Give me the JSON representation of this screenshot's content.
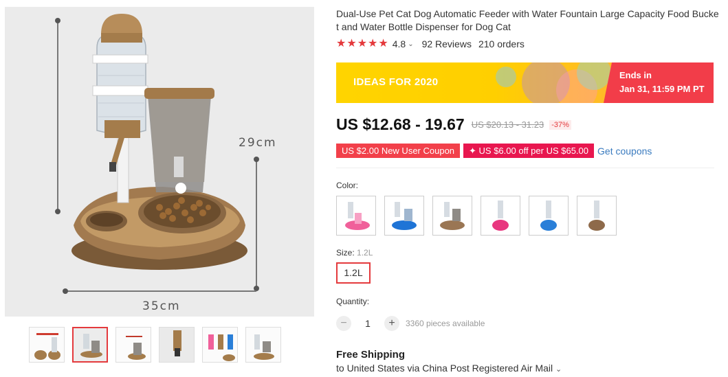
{
  "main_image": {
    "width_label": "35cm",
    "height_label": "29cm"
  },
  "thumbnails": [
    {
      "name": "thumbnail-1"
    },
    {
      "name": "thumbnail-2",
      "active": true
    },
    {
      "name": "thumbnail-3"
    },
    {
      "name": "thumbnail-4"
    },
    {
      "name": "thumbnail-5"
    },
    {
      "name": "thumbnail-6"
    }
  ],
  "product": {
    "title": "Dual-Use Pet Cat Dog Automatic Feeder with Water Fountain Large Capacity Food Bucket and Water Bottle Dispenser for Dog Cat",
    "rating": "4.8",
    "star_count": 5,
    "reviews": "92 Reviews",
    "orders": "210 orders"
  },
  "banner": {
    "promo_text": "IDEAS FOR 2020",
    "ends_label": "Ends in",
    "ends_value": "Jan 31, 11:59 PM PT"
  },
  "price": {
    "current": "US $12.68 - 19.67",
    "original": "US $20.13 - 31.23",
    "discount": "-37%"
  },
  "coupons": {
    "new_user": "US $2.00 New User Coupon",
    "store": "✦ US $6.00 off per US $65.00",
    "get_coupons": "Get coupons"
  },
  "color": {
    "label": "Color:",
    "options": [
      {
        "name": "pink-bottle-stand",
        "color": "#f0609a"
      },
      {
        "name": "blue-feeder-combo",
        "color": "#1f74d6"
      },
      {
        "name": "gold-feeder-combo",
        "color": "#9a7654"
      },
      {
        "name": "pink-bottle-bowl",
        "color": "#e8377f"
      },
      {
        "name": "blue-bottle-bowl",
        "color": "#2a7fd8"
      },
      {
        "name": "gold-bottle-bowl",
        "color": "#8e6a4a"
      }
    ]
  },
  "size": {
    "label": "Size:",
    "selected": "1.2L",
    "option": "1.2L"
  },
  "quantity": {
    "label": "Quantity:",
    "value": "1",
    "minus": "−",
    "plus": "+",
    "available": "3360 pieces available"
  },
  "shipping": {
    "title": "Free Shipping",
    "detail": "to United States via China Post Registered Air Mail",
    "chevron": "⌄"
  },
  "colors": {
    "accent": "#e4393c",
    "link": "#3a7bbf",
    "banner_yellow": "#ffd400",
    "banner_red": "#f23d49"
  }
}
